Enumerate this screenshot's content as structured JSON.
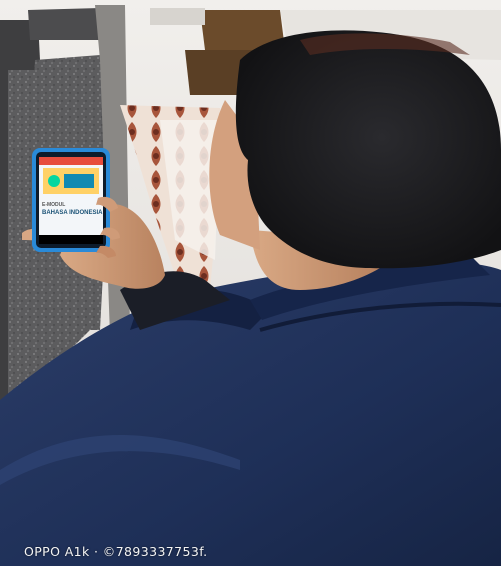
{
  "photo": {
    "watermark": "OPPO A1k · ©7893337753f.",
    "phone_screen": {
      "small_label": "E-MODUL",
      "title": "BAHASA INDONESIA"
    }
  },
  "colors": {
    "jacket": "#1e2f57",
    "hair": "#1a1a1d",
    "skin": "#c99674",
    "phone_case": "#2a8ad8",
    "floor": "#e9e6e2",
    "granite": "#5a5a5c"
  }
}
